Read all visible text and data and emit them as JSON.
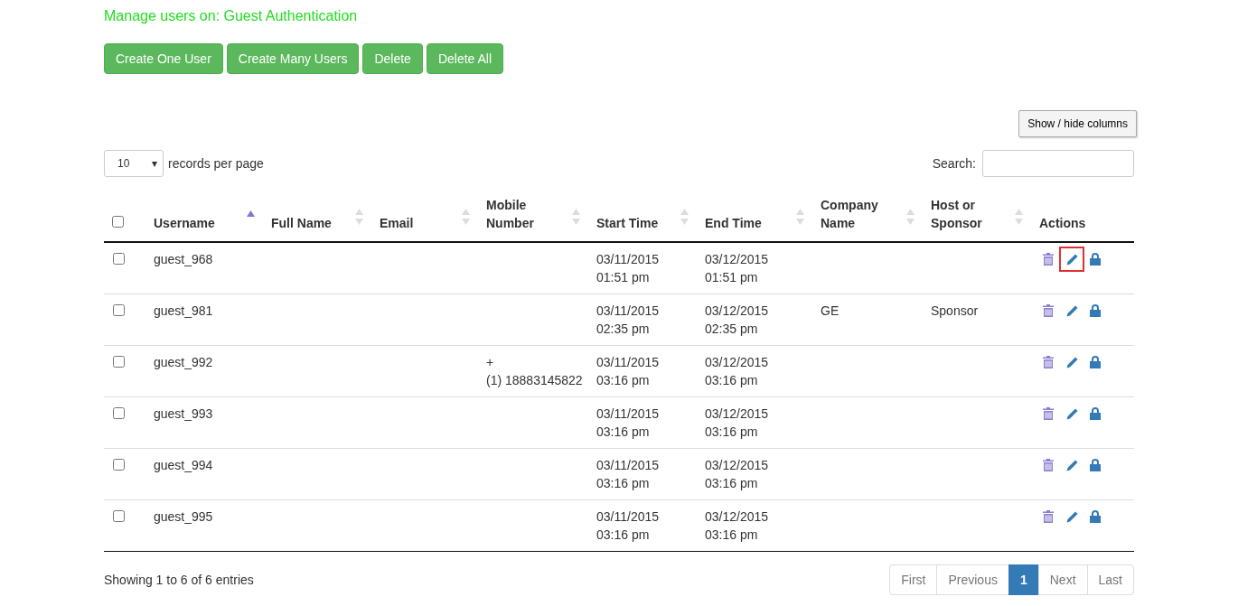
{
  "title": "Manage users on: Guest Authentication",
  "buttons": [
    "Create One User",
    "Create Many Users",
    "Delete",
    "Delete All"
  ],
  "columns_button": "Show / hide columns",
  "page_size": {
    "value": "10",
    "arrow": "▾",
    "label": "records per page"
  },
  "search": {
    "label": "Search:"
  },
  "select_all_checked": false,
  "columns": [
    {
      "label": "Username",
      "sortable": true,
      "sorted": true
    },
    {
      "label": "Full Name",
      "sortable": true,
      "sorted": false
    },
    {
      "label": "Email",
      "sortable": true,
      "sorted": false
    },
    {
      "label": "Mobile Number",
      "sortable": true,
      "sorted": false
    },
    {
      "label": "Start Time",
      "sortable": true,
      "sorted": false
    },
    {
      "label": "End Time",
      "sortable": true,
      "sorted": false
    },
    {
      "label": "Company Name",
      "sortable": true,
      "sorted": false
    },
    {
      "label": "Host or Sponsor",
      "sortable": true,
      "sorted": false
    },
    {
      "label": "Actions",
      "sortable": false
    }
  ],
  "rows": [
    {
      "checked": false,
      "cells": [
        "guest_968",
        "",
        "",
        "",
        "03/11/2015\n01:51 pm",
        "03/12/2015\n01:51 pm",
        "",
        ""
      ],
      "edit_highlighted": true
    },
    {
      "checked": false,
      "cells": [
        "guest_981",
        "",
        "",
        "",
        "03/11/2015\n02:35 pm",
        "03/12/2015\n02:35 pm",
        "GE",
        "Sponsor"
      ],
      "edit_highlighted": false
    },
    {
      "checked": false,
      "cells": [
        "guest_992",
        "",
        "",
        "+\n(1) 18883145822",
        "03/11/2015\n03:16 pm",
        "03/12/2015\n03:16 pm",
        "",
        ""
      ],
      "edit_highlighted": false
    },
    {
      "checked": false,
      "cells": [
        "guest_993",
        "",
        "",
        "",
        "03/11/2015\n03:16 pm",
        "03/12/2015\n03:16 pm",
        "",
        ""
      ],
      "edit_highlighted": false
    },
    {
      "checked": false,
      "cells": [
        "guest_994",
        "",
        "",
        "",
        "03/11/2015\n03:16 pm",
        "03/12/2015\n03:16 pm",
        "",
        ""
      ],
      "edit_highlighted": false
    },
    {
      "checked": false,
      "cells": [
        "guest_995",
        "",
        "",
        "",
        "03/11/2015\n03:16 pm",
        "03/12/2015\n03:16 pm",
        "",
        ""
      ],
      "edit_highlighted": false
    }
  ],
  "info": "Showing 1 to 6 of 6 entries",
  "pagination": [
    {
      "label": "First",
      "selected": false
    },
    {
      "label": "Previous",
      "selected": false
    },
    {
      "label": "1",
      "selected": true
    },
    {
      "label": "Next",
      "selected": false
    },
    {
      "label": "Last",
      "selected": false
    }
  ]
}
